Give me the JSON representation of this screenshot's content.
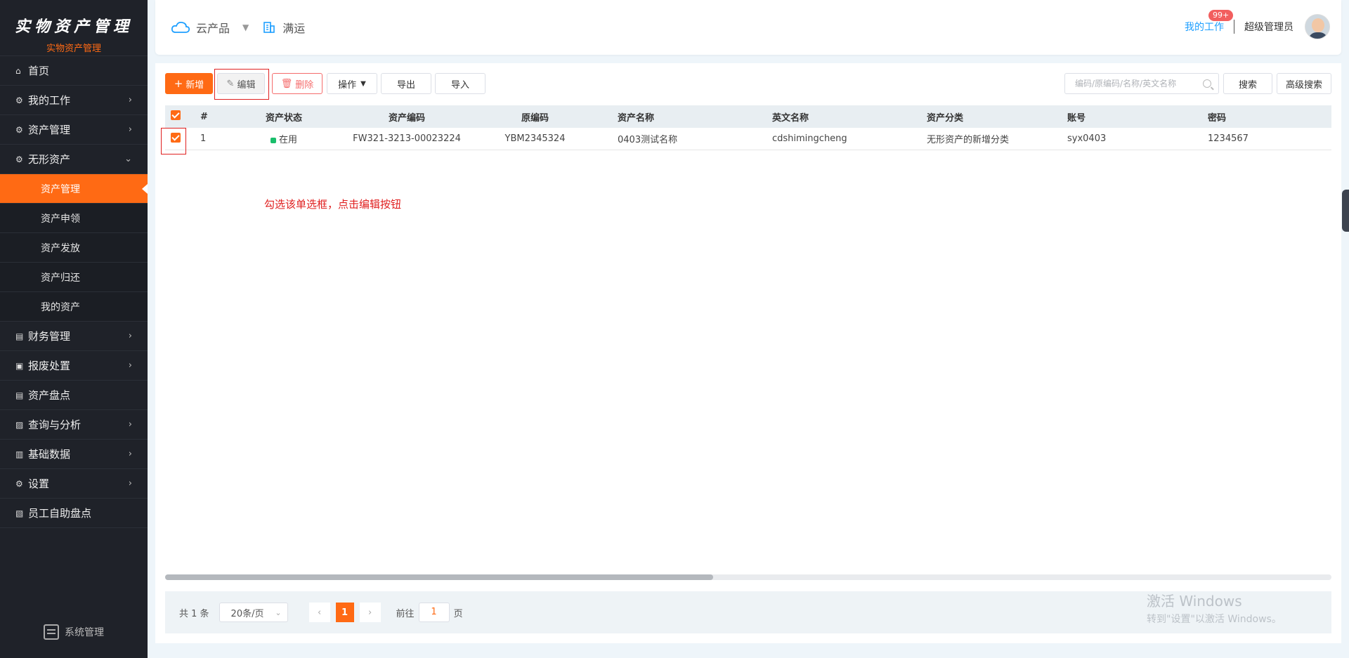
{
  "sidebar": {
    "brand_title": "实物资产管理",
    "brand_sub": "实物资产管理",
    "items": [
      {
        "label": "首页",
        "icon": "home-icon"
      },
      {
        "label": "我的工作",
        "icon": "gear-icon"
      },
      {
        "label": "资产管理",
        "icon": "gear-icon"
      },
      {
        "label": "无形资产",
        "icon": "gear-icon"
      }
    ],
    "sub_items": [
      {
        "label": "资产管理",
        "active": true
      },
      {
        "label": "资产申领"
      },
      {
        "label": "资产发放"
      },
      {
        "label": "资产归还"
      },
      {
        "label": "我的资产"
      }
    ],
    "items2": [
      {
        "label": "财务管理",
        "icon": "finance-icon"
      },
      {
        "label": "报废处置",
        "icon": "dispose-icon"
      },
      {
        "label": "资产盘点",
        "icon": "inventory-icon"
      },
      {
        "label": "查询与分析",
        "icon": "analysis-icon"
      },
      {
        "label": "基础数据",
        "icon": "chart-icon"
      },
      {
        "label": "设置",
        "icon": "gear-icon"
      },
      {
        "label": "员工自助盘点",
        "icon": "checklist-icon"
      }
    ],
    "system_label": "系统管理"
  },
  "header": {
    "product": "云产品",
    "org": "满运",
    "my_work": "我的工作",
    "badge": "99+",
    "user": "超级管理员"
  },
  "toolbar": {
    "add": "新增",
    "edit": "编辑",
    "delete": "删除",
    "ops": "操作",
    "export": "导出",
    "import": "导入",
    "search_placeholder": "编码/原编码/名称/英文名称",
    "search": "搜索",
    "advanced": "高级搜索"
  },
  "table": {
    "headers": {
      "idx": "#",
      "status": "资产状态",
      "code": "资产编码",
      "orig": "原编码",
      "name": "资产名称",
      "en": "英文名称",
      "cat": "资产分类",
      "acct": "账号",
      "pwd": "密码"
    },
    "rows": [
      {
        "idx": "1",
        "status": "在用",
        "code": "FW321-3213-00023224",
        "orig": "YBM2345324",
        "name": "0403测试名称",
        "en": "cdshimingcheng",
        "cat": "无形资产的新增分类",
        "acct": "syx0403",
        "pwd": "1234567"
      }
    ]
  },
  "annotation": "勾选该单选框，点击编辑按钮",
  "pager": {
    "total": "共 1 条",
    "size": "20条/页",
    "current": "1",
    "goto": "前往",
    "goto_value": "1",
    "page": "页"
  },
  "windows": {
    "line1": "激活 Windows",
    "line2": "转到\"设置\"以激活 Windows。"
  },
  "colors": {
    "accent": "#ff6a14",
    "sidebar_bg": "#1f2229",
    "link": "#1e9fff",
    "danger": "#f56c6c",
    "highlight": "#e02020"
  }
}
